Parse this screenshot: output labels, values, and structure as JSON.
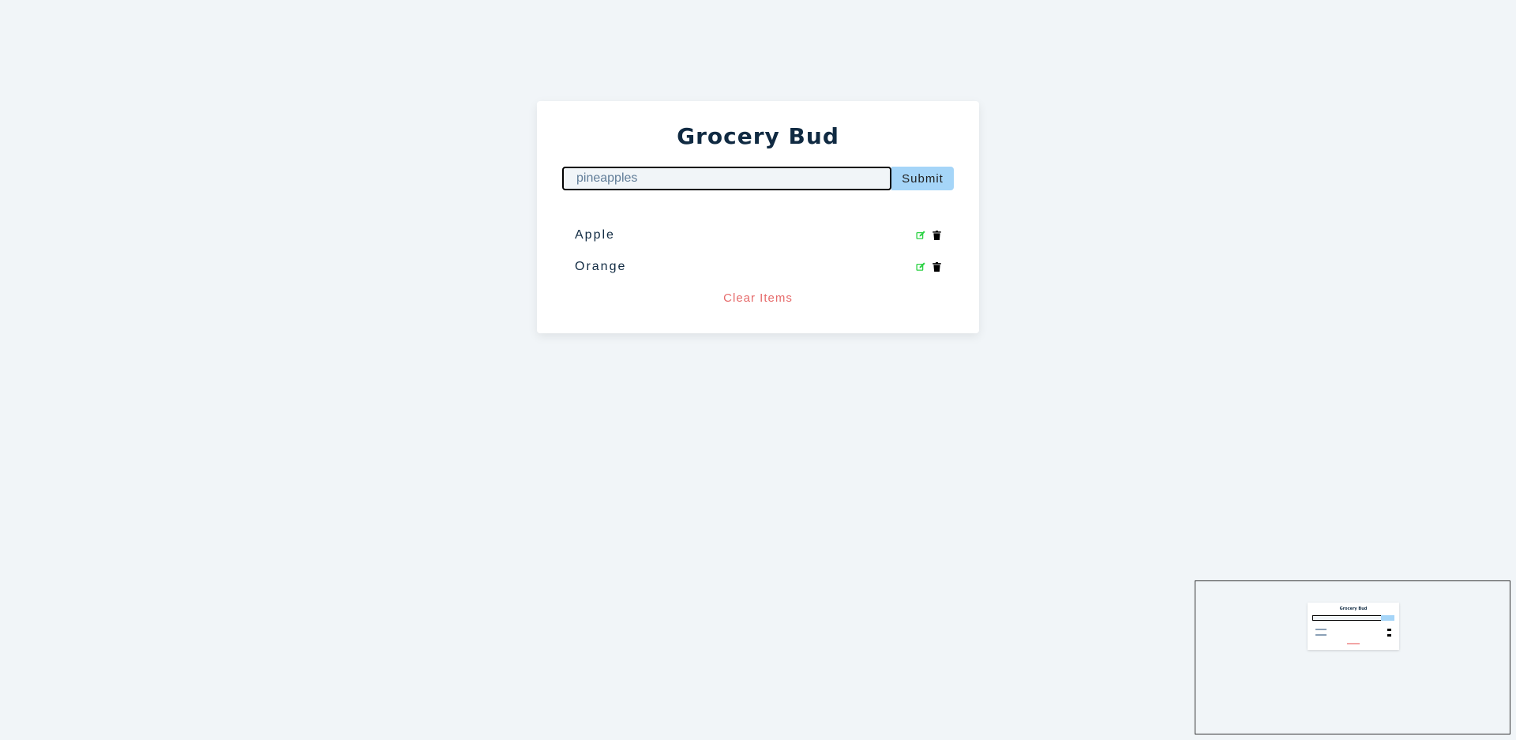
{
  "app": {
    "title": "Grocery Bud"
  },
  "form": {
    "input_value": "pineapples",
    "submit_label": "Submit"
  },
  "items": [
    {
      "title": "Apple",
      "edit_icon": "edit-icon",
      "delete_icon": "trash-icon"
    },
    {
      "title": "Orange",
      "edit_icon": "edit-icon",
      "delete_icon": "trash-icon"
    }
  ],
  "clear_label": "Clear Items",
  "colors": {
    "title": "#102a42",
    "submit_bg": "#a5d5f8",
    "edit_icon": "#2dd245",
    "delete_icon": "#000000",
    "clear_text": "#e66b6b",
    "page_bg": "#f1f5f8"
  }
}
